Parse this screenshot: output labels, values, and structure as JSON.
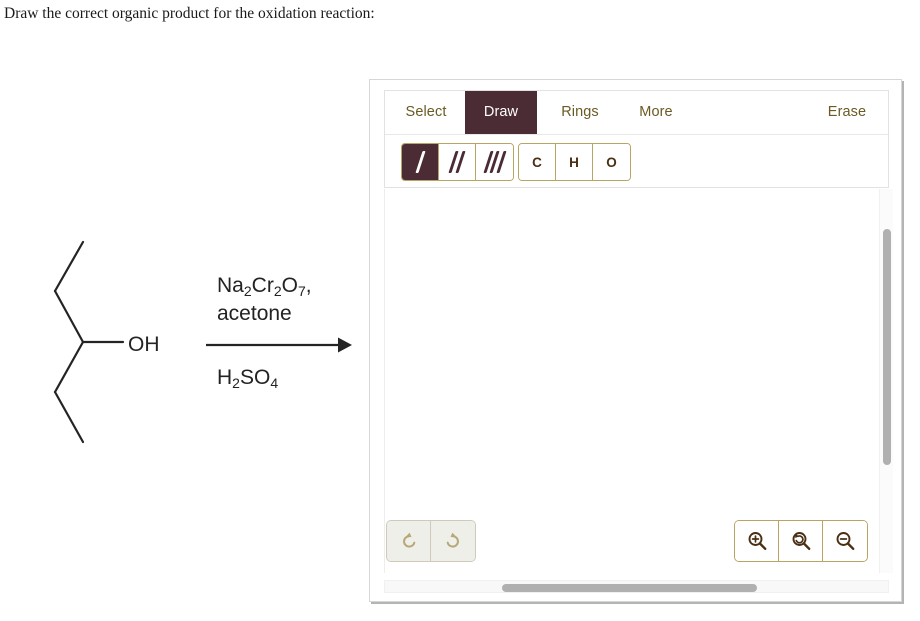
{
  "question": {
    "prompt": "Draw the correct organic product for the oxidation reaction:"
  },
  "reaction": {
    "reactant": {
      "name": "3-pentanol",
      "hydroxyl_label": "OH",
      "description": "skeletal-structure-pentan-3-ol"
    },
    "arrow": {
      "name": "reaction-arrow",
      "direction": "right"
    },
    "reagents_above_line1": "Na2Cr2O7,",
    "reagents_above_line2": "acetone",
    "reagents_below": "H2SO4",
    "reagent_above_formula": "Na",
    "reagent_above_sub1": "2",
    "reagent_above_cr": "Cr",
    "reagent_above_sub2": "2",
    "reagent_above_o": "O",
    "reagent_above_sub3": "7",
    "reagent_above_comma": ",",
    "reagent_above_solvent": "acetone",
    "reagent_below_h": "H",
    "reagent_below_sub1": "2",
    "reagent_below_so": "SO",
    "reagent_below_sub2": "4"
  },
  "drawing_tool": {
    "tabs": [
      {
        "id": "select",
        "label": "Select",
        "active": false
      },
      {
        "id": "draw",
        "label": "Draw",
        "active": true
      },
      {
        "id": "rings",
        "label": "Rings",
        "active": false
      },
      {
        "id": "more",
        "label": "More",
        "active": false
      },
      {
        "id": "erase",
        "label": "Erase",
        "active": false
      }
    ],
    "bond_tools": [
      {
        "id": "single-bond",
        "icon": "single-bond-icon",
        "selected": true
      },
      {
        "id": "double-bond",
        "icon": "double-bond-icon",
        "selected": false
      },
      {
        "id": "triple-bond",
        "icon": "triple-bond-icon",
        "selected": false
      }
    ],
    "element_tools": [
      {
        "id": "carbon",
        "label": "C"
      },
      {
        "id": "hydrogen",
        "label": "H"
      },
      {
        "id": "oxygen",
        "label": "O"
      }
    ],
    "history_buttons": [
      {
        "id": "undo",
        "icon": "undo-arrow-icon"
      },
      {
        "id": "redo",
        "icon": "redo-arrow-icon"
      }
    ],
    "zoom_buttons": [
      {
        "id": "zoom-in",
        "icon": "magnifier-plus-icon"
      },
      {
        "id": "zoom-reset",
        "icon": "magnifier-reset-icon"
      },
      {
        "id": "zoom-out",
        "icon": "magnifier-minus-icon"
      }
    ],
    "canvas": {
      "content": "",
      "state": "empty"
    },
    "colors": {
      "active_tab_bg": "#4b2c34",
      "tab_text": "#6b5a24",
      "button_border": "#b8a463",
      "element_text": "#4a2f14",
      "history_icon": "#b6a878",
      "scrollbar_thumb": "#b0b0b0"
    }
  }
}
